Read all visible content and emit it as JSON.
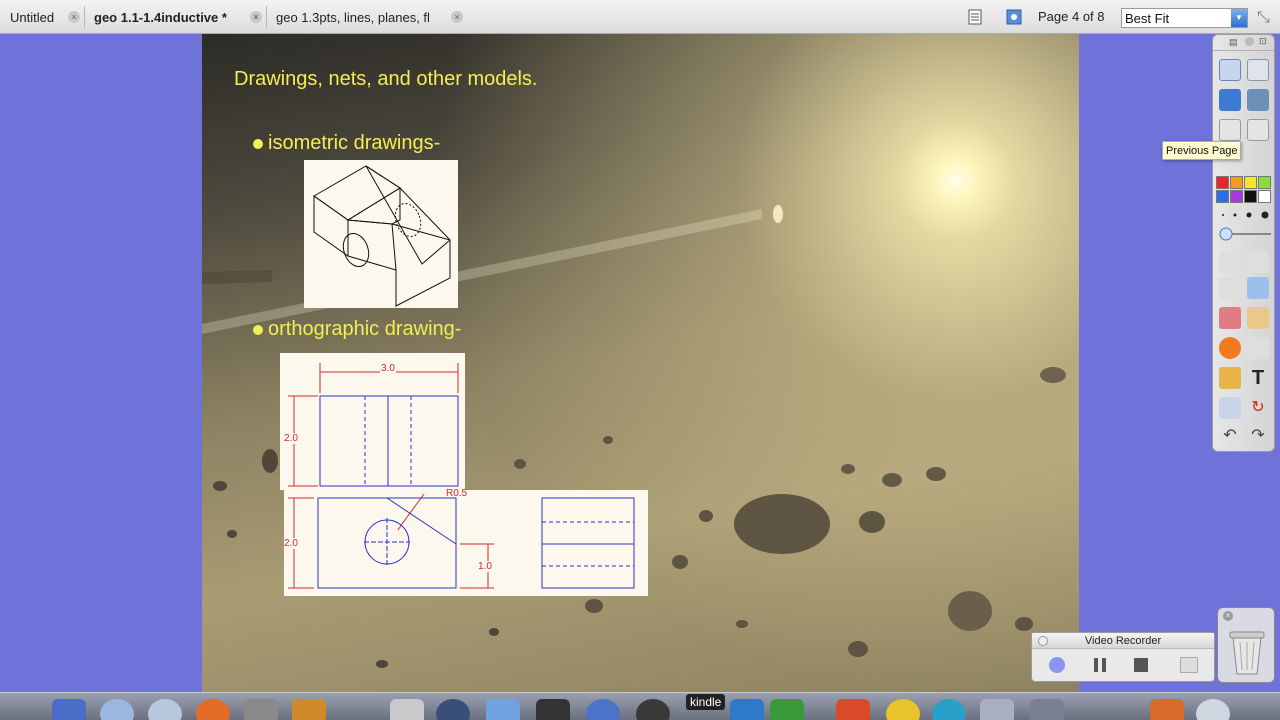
{
  "tabs": [
    {
      "label": "Untitled",
      "active": false
    },
    {
      "label": "geo 1.1-1.4inductive *",
      "active": true
    },
    {
      "label": "geo 1.3pts, lines, planes, fl",
      "active": false
    }
  ],
  "toolbar": {
    "page_indicator": "Page 4 of 8",
    "zoom_select": "Best Fit"
  },
  "slide": {
    "title": "Drawings, nets, and other models.",
    "bullets": [
      {
        "label": "isometric drawings-"
      },
      {
        "label": "orthographic drawing-"
      }
    ],
    "ortho_dimensions": {
      "width": "3.0",
      "height_top": "2.0",
      "height_front": "2.0",
      "radius": "R0.5",
      "step": "1.0"
    }
  },
  "tooltip": "Previous Page",
  "palette": {
    "colors": [
      "#e8262a",
      "#f59a23",
      "#f5e62a",
      "#8ddd3a",
      "#2a6ee8",
      "#a33ae0",
      "#111111",
      "#ffffff"
    ],
    "tools": [
      "page-sorter-icon",
      "gallery-icon",
      "signature-icon",
      "magic-icon",
      "previous-page-icon",
      "next-page-icon",
      "select-icon",
      "resize-icon",
      "pen-icon",
      "highlighter-icon",
      "eraser-icon",
      "fill-icon",
      "shapes-icon",
      "line-icon",
      "screen-capture-icon",
      "text-icon",
      "rotate-icon",
      "refresh-icon",
      "undo-icon",
      "redo-icon"
    ]
  },
  "video_recorder": {
    "title": "Video Recorder",
    "controls": [
      "record",
      "pause",
      "stop",
      "play"
    ]
  },
  "dock": {
    "kindle_label": "kindle"
  }
}
